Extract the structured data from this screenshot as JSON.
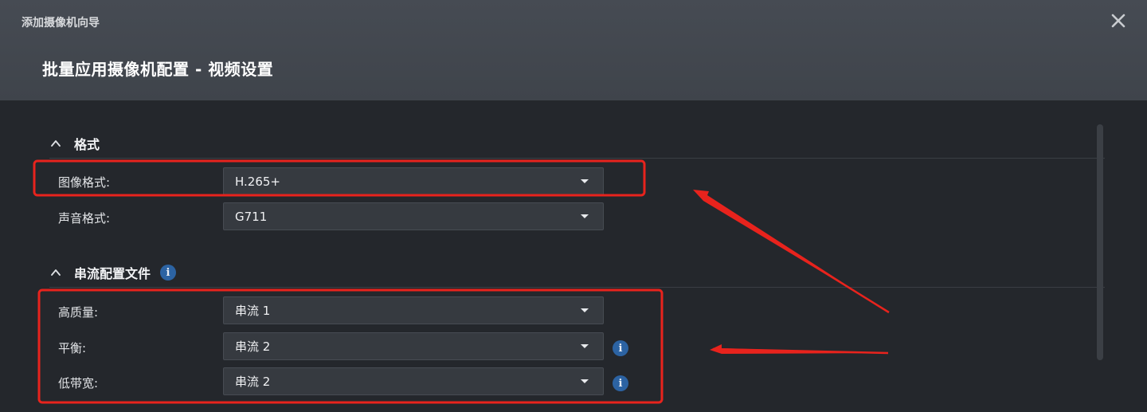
{
  "wizard": {
    "title": "添加摄像机向导",
    "page_title": "批量应用摄像机配置 - 视频设置"
  },
  "sections": {
    "format": {
      "title": "格式",
      "rows": [
        {
          "label": "图像格式:",
          "value": "H.265+"
        },
        {
          "label": "声音格式:",
          "value": "G711"
        }
      ]
    },
    "stream_profile": {
      "title": "串流配置文件",
      "rows": [
        {
          "label": "高质量:",
          "value": "串流 1"
        },
        {
          "label": "平衡:",
          "value": "串流 2"
        },
        {
          "label": "低带宽:",
          "value": "串流 2"
        }
      ]
    }
  },
  "icons": {
    "close": "close-icon",
    "collapse": "chevron-up-icon",
    "info": "info-icon",
    "dropdown": "caret-down-icon"
  },
  "info_glyph": "i",
  "colors": {
    "header_bg": "#444950",
    "content_bg": "#24272c",
    "select_bg": "#363a40",
    "info_blue": "#2c63a3",
    "annotation_red": "#e8231d"
  }
}
